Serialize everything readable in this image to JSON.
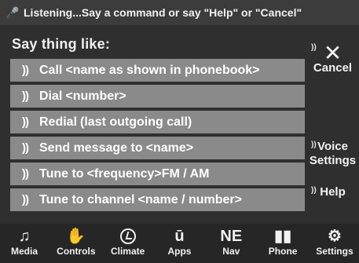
{
  "status": {
    "icon": "voice-listening-icon",
    "text": "Listening...Say a command or say \"Help\" or \"Cancel\""
  },
  "prompt": "Say thing like:",
  "commands": [
    {
      "main": "Call",
      "suffix": "<name as shown in phonebook>"
    },
    {
      "main": "Dial",
      "suffix": "<number>"
    },
    {
      "main": "Redial",
      "suffix": "(last outgoing call)"
    },
    {
      "main": "Send message to",
      "suffix": "<name>"
    },
    {
      "main": "Tune to",
      "suffix": "<frequency>FM / AM"
    },
    {
      "main": "Tune to channel",
      "suffix": "<name / number>"
    }
  ],
  "right_panel": {
    "cancel_label": "Cancel",
    "voice_settings_label_line1": "Voice",
    "voice_settings_label_line2": "Settings",
    "help_label": "Help"
  },
  "bottom_nav": [
    {
      "label": "Media",
      "icon": "music-note-icon"
    },
    {
      "label": "Controls",
      "icon": "hand-icon"
    },
    {
      "label": "Climate",
      "icon": "climate-icon"
    },
    {
      "label": "Apps",
      "icon": "apps-icon"
    },
    {
      "label": "Nav",
      "icon": "compass-icon"
    },
    {
      "label": "Phone",
      "icon": "phone-signal-icon"
    },
    {
      "label": "Settings",
      "icon": "gear-icon"
    }
  ],
  "colors": {
    "background": "#2f2f2f",
    "status_bar": "#3c3c3c",
    "command_bg": "#8a8a8a",
    "bottom_nav": "#262626",
    "text": "#f2f2f2"
  }
}
